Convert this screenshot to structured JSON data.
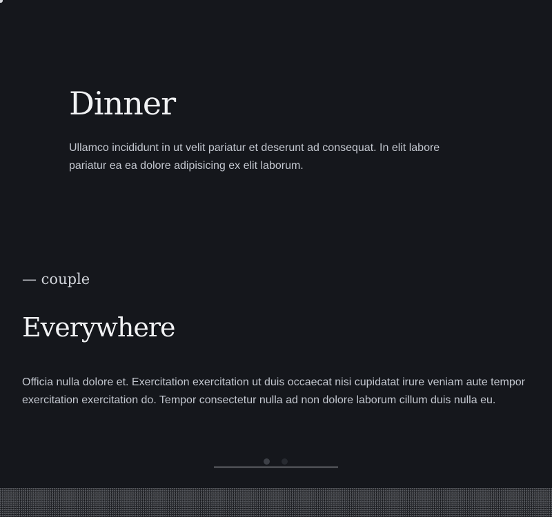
{
  "dinner": {
    "title": "Dinner",
    "body": "Ullamco incididunt in ut velit pariatur et deserunt ad consequat. In elit labore pariatur ea ea dolore adipisicing ex elit laborum."
  },
  "couple": {
    "eyebrow": "— couple",
    "title": "Everywhere",
    "body": "Officia nulla dolore et. Exercitation exercitation ut duis occaecat nisi cupidatat irure veniam aute tempor exercitation exercitation do. Tempor consectetur nulla ad non dolore laborum cillum duis nulla eu."
  },
  "carousel": {
    "total_slides": 2,
    "active_slide": 1
  },
  "colors": {
    "background": "#15171c",
    "heading": "#f1f2f4",
    "body_text": "#c3c7cf",
    "dot_active": "#3d4047",
    "dot_inactive": "#272a30"
  }
}
